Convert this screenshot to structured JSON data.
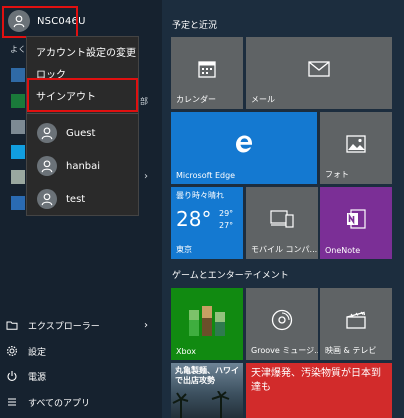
{
  "user": {
    "name": "NSC046U"
  },
  "account_menu": {
    "change_settings": "アカウント設定の変更",
    "lock": "ロック",
    "sign_out": "サインアウト",
    "users": [
      "Guest",
      "hanbai",
      "test"
    ]
  },
  "left_partial": {
    "often_used": "よく使",
    "bottom_cut": "部"
  },
  "bottom_nav": {
    "explorer": "エクスプローラー",
    "settings": "設定",
    "power": "電源",
    "all_apps": "すべてのアプリ"
  },
  "groups": {
    "group1": "予定と近況",
    "group2": "ゲームとエンターテイメント"
  },
  "tiles": {
    "calendar": "カレンダー",
    "mail": "メール",
    "edge": "Microsoft Edge",
    "photos": "フォト",
    "weather_title": "曇り時々晴れ",
    "weather_temp": "28°",
    "weather_high": "29°",
    "weather_low": "27°",
    "weather_city": "東京",
    "mobile": "モバイル コンパ...",
    "onenote": "OneNote",
    "xbox": "Xbox",
    "groove": "Groove ミュージ...",
    "movies": "映画 & テレビ",
    "news_left": "丸亀製麺、ハワイで出店攻勢",
    "news_right": "天津爆発、汚染物質が日本到達も"
  },
  "colors": {
    "highlight_red": "#e01010",
    "tile_gray": "#5f6365",
    "tile_blue": "#1479d1",
    "onenote_purple": "#7b2f96",
    "xbox_green": "#118a11",
    "news_red": "#d22b2b"
  }
}
